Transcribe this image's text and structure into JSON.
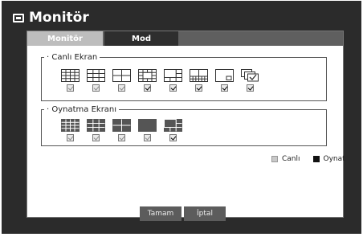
{
  "window": {
    "title": "Monitör"
  },
  "tabs": [
    {
      "label": "Monitör"
    },
    {
      "label": "Mod"
    }
  ],
  "live": {
    "label": "Canlı Ekran",
    "layouts": [
      {
        "icon": "grid-16-icon",
        "checked": false
      },
      {
        "icon": "grid-9-icon",
        "checked": false
      },
      {
        "icon": "grid-4-icon",
        "checked": false
      },
      {
        "icon": "grid-8-icon",
        "checked": true
      },
      {
        "icon": "grid-6-icon",
        "checked": true
      },
      {
        "icon": "grid-13-icon",
        "checked": true
      },
      {
        "icon": "pip-icon",
        "checked": true
      },
      {
        "icon": "sequence-icon",
        "checked": true
      }
    ]
  },
  "playback": {
    "label": "Oynatma Ekranı",
    "layouts": [
      {
        "icon": "grid-16-icon",
        "checked": false
      },
      {
        "icon": "grid-9-icon",
        "checked": false
      },
      {
        "icon": "grid-4-icon",
        "checked": false
      },
      {
        "icon": "single-icon",
        "checked": false
      },
      {
        "icon": "grid-6-icon",
        "checked": true
      }
    ]
  },
  "legend": {
    "live": "Canlı",
    "playback": "Oynat"
  },
  "buttons": {
    "ok": "Tamam",
    "cancel": "İptal"
  },
  "colors": {
    "background": "#2b2b2b",
    "active_tab": "#bdbdbd",
    "tab_strip": "#5f5f5f",
    "button": "#5c5c5c"
  }
}
